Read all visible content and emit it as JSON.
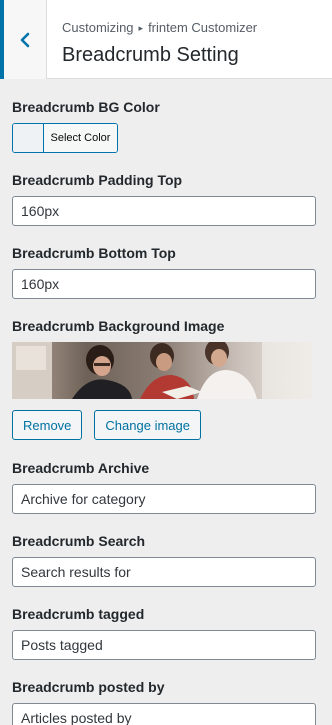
{
  "header": {
    "breadcrumb_parent": "Customizing",
    "breadcrumb_separator": "▸",
    "breadcrumb_child": "frintem Customizer",
    "title": "Breadcrumb Setting"
  },
  "fields": {
    "bg_color": {
      "label": "Breadcrumb BG Color",
      "button_label": "Select Color"
    },
    "padding_top": {
      "label": "Breadcrumb Padding Top",
      "value": "160px"
    },
    "bottom_top": {
      "label": "Breadcrumb Bottom Top",
      "value": "160px"
    },
    "background_image": {
      "label": "Breadcrumb Background Image",
      "remove_label": "Remove",
      "change_label": "Change image"
    },
    "archive": {
      "label": "Breadcrumb Archive",
      "value": "Archive for category"
    },
    "search": {
      "label": "Breadcrumb Search",
      "value": "Search results for"
    },
    "tagged": {
      "label": "Breadcrumb tagged",
      "value": "Posts tagged"
    },
    "posted_by": {
      "label": "Breadcrumb posted by",
      "value": "Articles posted by"
    }
  },
  "colors": {
    "accent": "#0073aa",
    "panel_background": "#eeeeee"
  },
  "icons": {
    "back": "chevron-left-icon"
  }
}
